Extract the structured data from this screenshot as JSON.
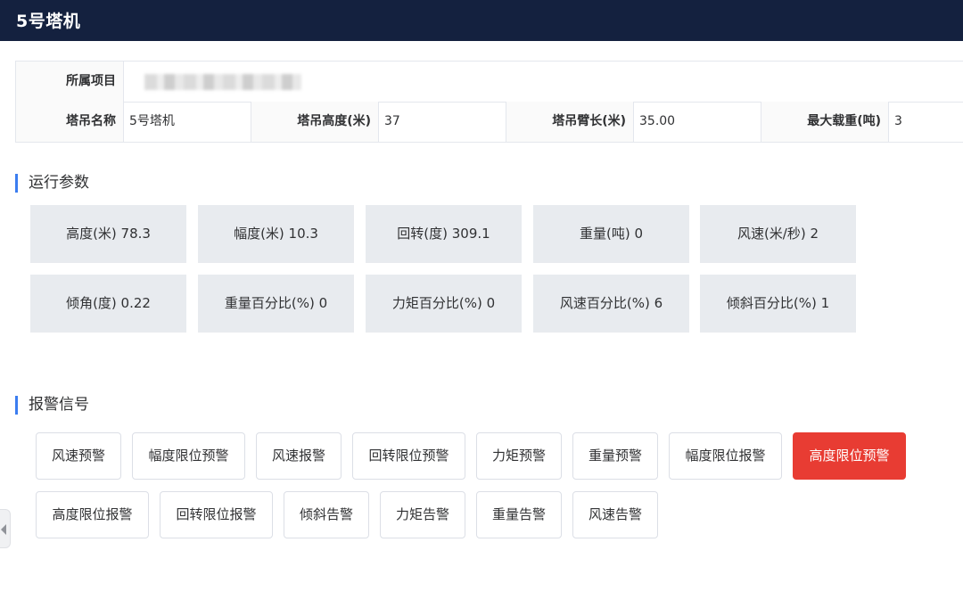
{
  "header": {
    "title": "5号塔机"
  },
  "info": {
    "project_label": "所属项目",
    "project_value": "",
    "name_label": "塔吊名称",
    "name_value": "5号塔机",
    "height_label": "塔吊高度(米)",
    "height_value": "37",
    "arm_label": "塔吊臂长(米)",
    "arm_value": "35.00",
    "load_label": "最大载重(吨)",
    "load_value": "3"
  },
  "params": {
    "title": "运行参数",
    "items": [
      "高度(米) 78.3",
      "幅度(米) 10.3",
      "回转(度) 309.1",
      "重量(吨) 0",
      "风速(米/秒) 2",
      "倾角(度) 0.22",
      "重量百分比(%) 0",
      "力矩百分比(%) 0",
      "风速百分比(%) 6",
      "倾斜百分比(%) 1"
    ]
  },
  "alarms": {
    "title": "报警信号",
    "items": [
      {
        "label": "风速预警",
        "active": false
      },
      {
        "label": "幅度限位预警",
        "active": false
      },
      {
        "label": "风速报警",
        "active": false
      },
      {
        "label": "回转限位预警",
        "active": false
      },
      {
        "label": "力矩预警",
        "active": false
      },
      {
        "label": "重量预警",
        "active": false
      },
      {
        "label": "幅度限位报警",
        "active": false
      },
      {
        "label": "高度限位预警",
        "active": true
      },
      {
        "label": "高度限位报警",
        "active": false
      },
      {
        "label": "回转限位报警",
        "active": false
      },
      {
        "label": "倾斜告警",
        "active": false
      },
      {
        "label": "力矩告警",
        "active": false
      },
      {
        "label": "重量告警",
        "active": false
      },
      {
        "label": "风速告警",
        "active": false
      }
    ],
    "active_color": "#e83c33"
  },
  "colors": {
    "header_bg": "#14213f",
    "accent": "#3b7df0",
    "param_bg": "#e8ebef"
  }
}
